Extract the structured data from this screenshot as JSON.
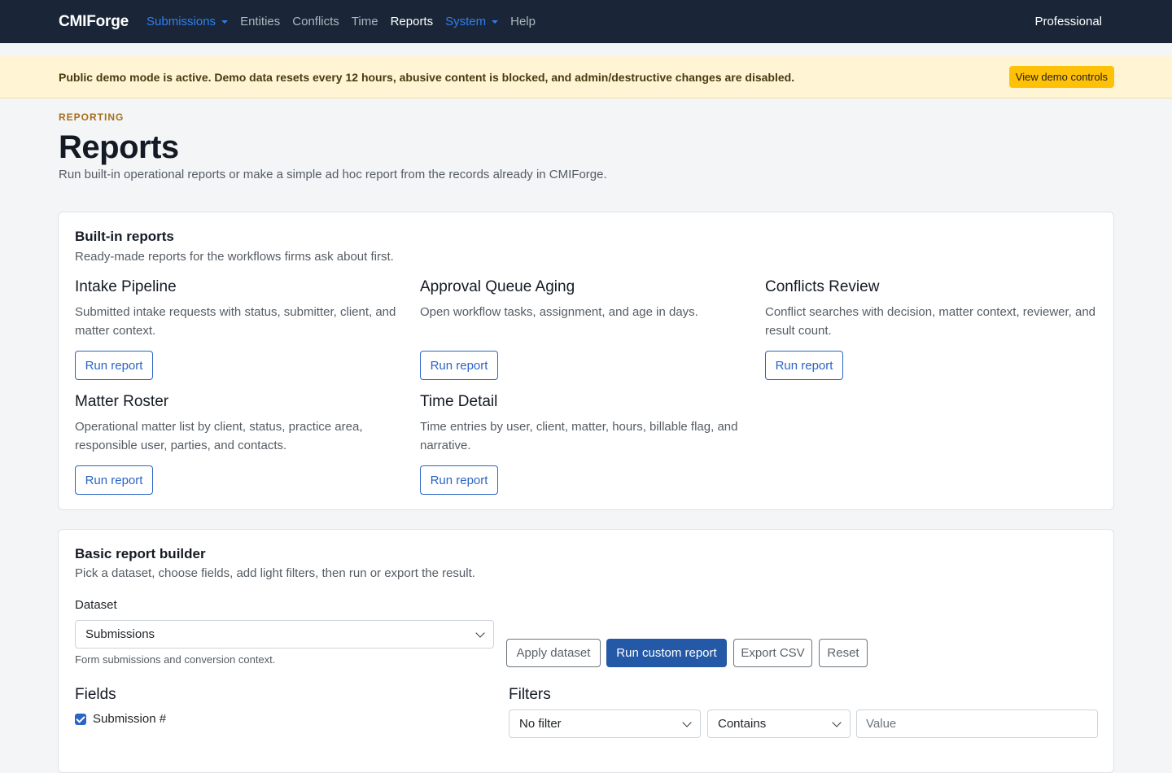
{
  "nav": {
    "brand": "CMIForge",
    "items": [
      {
        "label": "Submissions",
        "dropdown": true,
        "style": "blue"
      },
      {
        "label": "Entities",
        "dropdown": false,
        "style": "normal"
      },
      {
        "label": "Conflicts",
        "dropdown": false,
        "style": "normal"
      },
      {
        "label": "Time",
        "dropdown": false,
        "style": "normal"
      },
      {
        "label": "Reports",
        "dropdown": false,
        "style": "active"
      },
      {
        "label": "System",
        "dropdown": true,
        "style": "blue"
      },
      {
        "label": "Help",
        "dropdown": false,
        "style": "normal"
      }
    ],
    "plan": "Professional"
  },
  "banner": {
    "text": "Public demo mode is active. Demo data resets every 12 hours, abusive content is blocked, and admin/destructive changes are disabled.",
    "button": "View demo controls"
  },
  "header": {
    "eyebrow": "REPORTING",
    "title": "Reports",
    "subtitle": "Run built-in operational reports or make a simple ad hoc report from the records already in CMIForge."
  },
  "built_in": {
    "title": "Built-in reports",
    "subtitle": "Ready-made reports for the workflows firms ask about first.",
    "run_label": "Run report",
    "reports": [
      {
        "name": "Intake Pipeline",
        "desc": "Submitted intake requests with status, submitter, client, and matter context."
      },
      {
        "name": "Approval Queue Aging",
        "desc": "Open workflow tasks, assignment, and age in days."
      },
      {
        "name": "Conflicts Review",
        "desc": "Conflict searches with decision, matter context, reviewer, and result count."
      },
      {
        "name": "Matter Roster",
        "desc": "Operational matter list by client, status, practice area, responsible user, parties, and contacts."
      },
      {
        "name": "Time Detail",
        "desc": "Time entries by user, client, matter, hours, billable flag, and narrative."
      }
    ]
  },
  "builder": {
    "title": "Basic report builder",
    "subtitle": "Pick a dataset, choose fields, add light filters, then run or export the result.",
    "dataset_label": "Dataset",
    "dataset_value": "Submissions",
    "dataset_help": "Form submissions and conversion context.",
    "apply_label": "Apply dataset",
    "run_label": "Run custom report",
    "export_label": "Export CSV",
    "reset_label": "Reset",
    "fields_title": "Fields",
    "fields": [
      {
        "label": "Submission #",
        "checked": true
      }
    ],
    "filters_title": "Filters",
    "filter_field": "No filter",
    "filter_op": "Contains",
    "filter_value_placeholder": "Value"
  }
}
